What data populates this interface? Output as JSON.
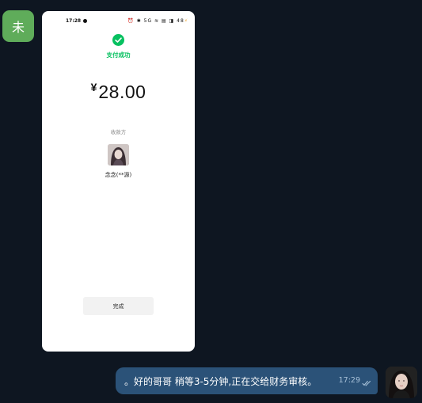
{
  "sender": {
    "avatar_text": "未",
    "avatar_color": "#5fac5a"
  },
  "payment_screenshot": {
    "status_bar": {
      "time": "17:28",
      "icons_text": "⏰ ✱ 5G ≋ ▤ ◨ 48"
    },
    "status_text": "支付成功",
    "currency_symbol": "¥",
    "amount": "28.00",
    "payee_label": "收款方",
    "payee_name": "念念(**源)",
    "done_button": "完成",
    "accent_color": "#07c160"
  },
  "outgoing_message": {
    "text": "。好的哥哥 稍等3-5分钟,正在交给财务审核。",
    "time": "17:29",
    "bubble_color": "#2b5278"
  },
  "icons": {
    "check": "check-icon",
    "read_receipt": "double-check-icon"
  }
}
